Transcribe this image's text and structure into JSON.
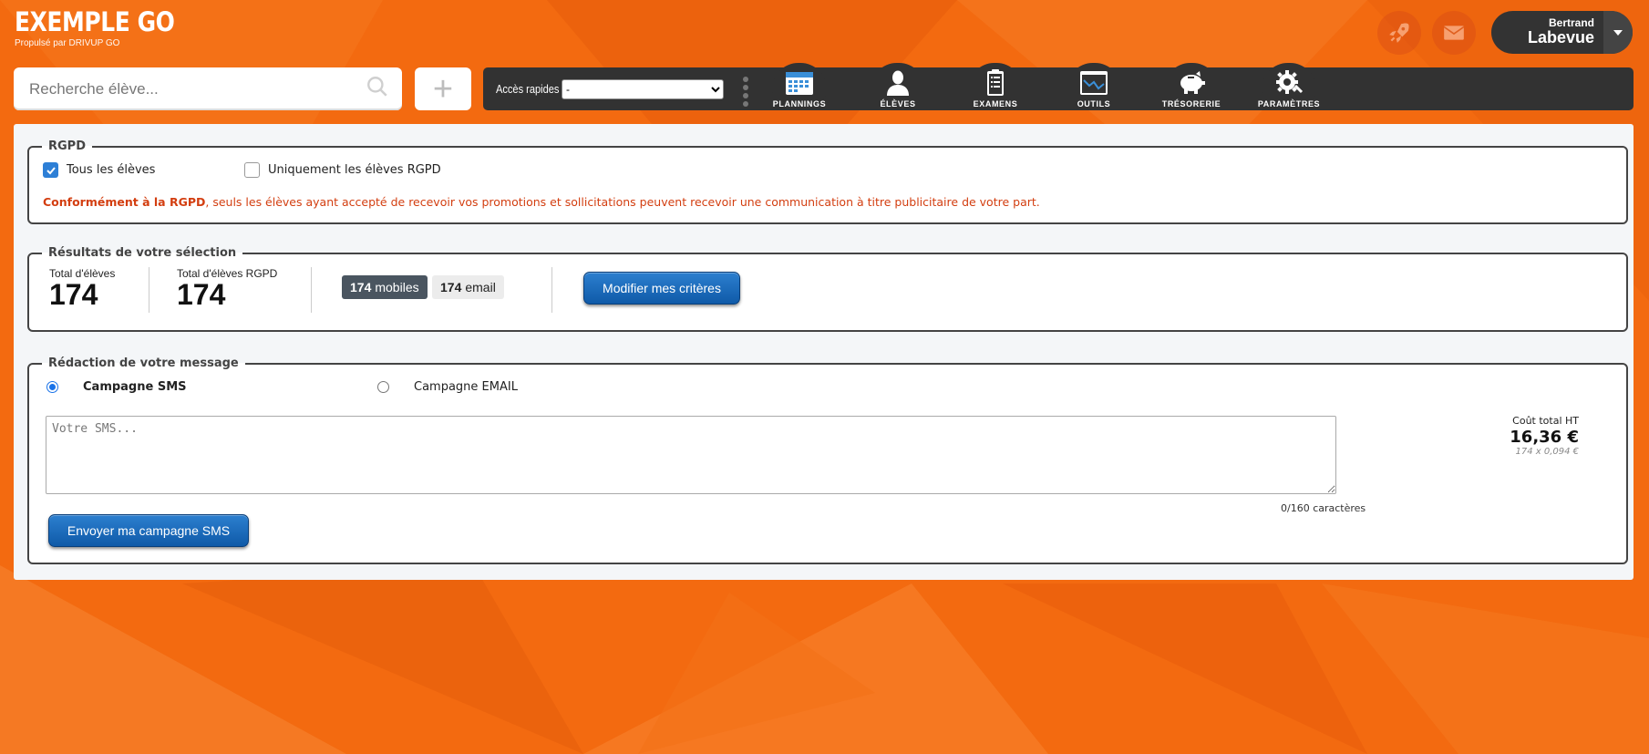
{
  "brand": {
    "title": "EXEMPLE GO",
    "subtitle": "Propulsé par DRIVUP GO"
  },
  "header": {
    "rocket_icon": "rocket-icon",
    "mail_icon": "envelope-icon",
    "user": {
      "first_name": "Bertrand",
      "last_name": "Labevue"
    }
  },
  "search": {
    "placeholder": "Recherche élève...",
    "value": "",
    "add_label": "+"
  },
  "toolbar": {
    "quick_access_label": "Accès rapides",
    "quick_access_value": "-",
    "nav": [
      {
        "label": "PLANNINGS",
        "icon": "calendar-icon"
      },
      {
        "label": "ÉLÈVES",
        "icon": "user-icon"
      },
      {
        "label": "EXAMENS",
        "icon": "clipboard-icon"
      },
      {
        "label": "OUTILS",
        "icon": "chart-window-icon"
      },
      {
        "label": "TRÉSORERIE",
        "icon": "piggy-bank-icon"
      },
      {
        "label": "PARAMÈTRES",
        "icon": "gear-icon"
      }
    ]
  },
  "rgpd": {
    "legend": "RGPD",
    "option_all": "Tous les élèves",
    "option_all_checked": true,
    "option_rgpd": "Uniquement les élèves RGPD",
    "option_rgpd_checked": false,
    "note_bold": "Conformément à la RGPD",
    "note_rest": ", seuls les élèves ayant accepté de recevoir vos promotions et sollicitations peuvent recevoir une communication à titre publicitaire de votre part."
  },
  "results": {
    "legend": "Résultats de votre sélection",
    "total_label": "Total d'élèves",
    "total_value": "174",
    "total_rgpd_label": "Total d'élèves RGPD",
    "total_rgpd_value": "174",
    "mobiles_count": "174",
    "mobiles_label": "mobiles",
    "email_count": "174",
    "email_label": "email",
    "modify_button": "Modifier mes critères"
  },
  "message": {
    "legend": "Rédaction de votre message",
    "option_sms": "Campagne SMS",
    "option_sms_selected": true,
    "option_email": "Campagne EMAIL",
    "option_email_selected": false,
    "sms_placeholder": "Votre SMS...",
    "sms_value": "",
    "char_count": "0/160 caractères",
    "cost_label": "Coût total HT",
    "cost_value": "16,36 €",
    "cost_detail": "174 x 0,094 €",
    "send_button": "Envoyer ma campagne SMS"
  },
  "colors": {
    "background": "#f36a10",
    "toolbar": "#323232",
    "button_blue": "#1466b8",
    "rgpd_note": "#d33e10",
    "checkbox_blue": "#2d7fd6"
  }
}
